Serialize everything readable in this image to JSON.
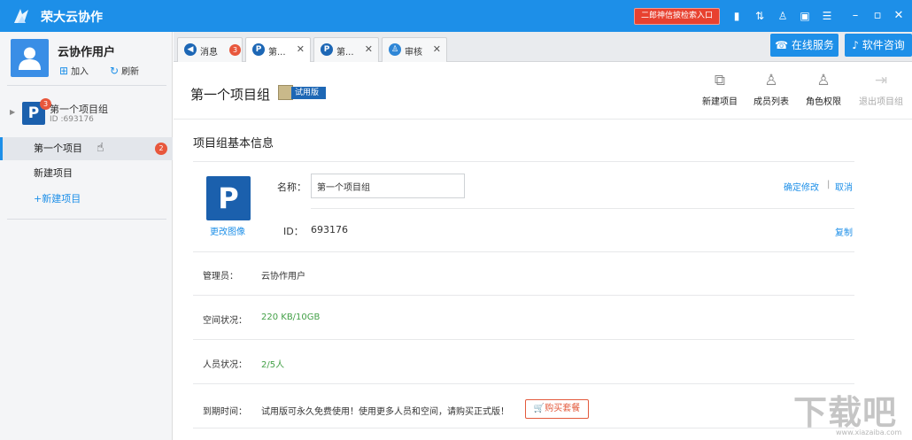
{
  "app": {
    "title": "荣大云协作",
    "promo_link": "二郎神信披检索入口",
    "titlebar_icons": [
      "signal-icon",
      "arrows-icon",
      "person-icon",
      "window-icon",
      "menu-icon"
    ],
    "window_controls": [
      "minimize",
      "maximize",
      "close"
    ]
  },
  "user": {
    "name": "云协作用户",
    "join_label": "加入",
    "refresh_label": "刷新"
  },
  "sidebar": {
    "group": {
      "name": "第一个项目组",
      "id_text": "ID :693176",
      "badge": "3",
      "logo_letter": "P"
    },
    "projects": [
      {
        "label": "第一个项目",
        "badge": "2"
      },
      {
        "label": "新建项目",
        "badge": ""
      }
    ],
    "new_project_label": "+新建项目"
  },
  "tabs": [
    {
      "label": "消息",
      "badge": "3",
      "icon": "speaker-icon"
    },
    {
      "label": "第...",
      "icon": "p-icon",
      "closable": true
    },
    {
      "label": "第...",
      "icon": "p-icon",
      "closable": true
    },
    {
      "label": "审核",
      "icon": "user-icon",
      "closable": true
    }
  ],
  "tab_buttons": {
    "online_service": "在线服务",
    "software_consult": "软件咨询"
  },
  "main": {
    "title": "第一个项目组",
    "trial_tag": "试用版",
    "toolbar": [
      {
        "label": "新建项目",
        "icon": "new-project-icon",
        "disabled": false
      },
      {
        "label": "成员列表",
        "icon": "member-list-icon",
        "disabled": false
      },
      {
        "label": "角色权限",
        "icon": "role-permission-icon",
        "disabled": false
      },
      {
        "label": "退出项目组",
        "icon": "exit-group-icon",
        "disabled": true
      }
    ],
    "section_title": "项目组基本信息",
    "change_image_label": "更改图像",
    "name_label": "名称：",
    "name_value": "第一个项目组",
    "confirm_label": "确定修改",
    "cancel_label": "取消",
    "id_label": "ID：",
    "id_value": "693176",
    "copy_label": "复制",
    "admin_label": "管理员：",
    "admin_value": "云协作用户",
    "space_label": "空间状况：",
    "space_value": "220 KB/10GB",
    "people_label": "人员状况：",
    "people_value": "2/5人",
    "expire_label": "到期时间：",
    "expire_value": "试用版可永久免费使用！使用更多人员和空间，请购买正式版！",
    "buy_label": "购买套餐"
  },
  "watermark": {
    "text": "下载吧",
    "url": "www.xiazaiba.com"
  },
  "colors": {
    "accent": "#1d8fe8",
    "badge": "#e8573c",
    "green": "#43a047"
  }
}
